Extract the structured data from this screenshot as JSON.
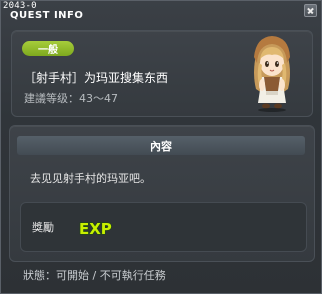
{
  "window": {
    "id_label": "2043-0",
    "title": "QUEST INFO"
  },
  "quest": {
    "category": "一般",
    "title": "［射手村］为玛亚搜集东西",
    "level": "建議等级：43～47"
  },
  "content": {
    "header": "內容",
    "text": "去见见射手村的玛亚吧。"
  },
  "reward": {
    "label": "獎勵",
    "exp_text": "EXP"
  },
  "status": {
    "text": "狀態：可開始 / 不可執行任務"
  },
  "colors": {
    "category_badge": "#94c02c",
    "exp_green": "#c8f000"
  }
}
